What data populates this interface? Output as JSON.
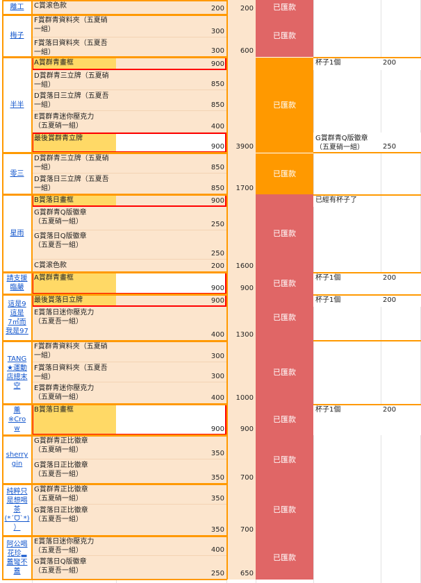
{
  "colors": {
    "peach": "#fce5cd",
    "yellow": "#ffd966",
    "red_status": "#e06666",
    "orange_status": "#ff9900",
    "orange_border": "#ff9900",
    "red_border": "#ff0000",
    "link": "#1155cc",
    "grid": "#e2e2e2"
  },
  "groups": [
    {
      "name": "離工",
      "total": "200",
      "status": "已匯款",
      "status_color": "red",
      "items": [
        {
          "text": "C賞滚色款",
          "price": "200"
        }
      ]
    },
    {
      "name": "梅子",
      "total": "600",
      "status": "已匯款",
      "status_color": "red",
      "items": [
        {
          "text": "F賞群青資料夾（五夏硝\n一組）",
          "price": "300"
        },
        {
          "text": "F賞落日資料夾（五夏吾\n一組）",
          "price": "300"
        }
      ]
    },
    {
      "name": "半半",
      "total": "3900",
      "status": "已匯款",
      "status_color": "orange",
      "items": [
        {
          "text": "A賞群青畫框",
          "price": "900",
          "hl": true
        },
        {
          "text": "D賞群青三立牌（五夏硝\n一組）",
          "price": "850"
        },
        {
          "text": "D賞落日三立牌（五夏吾\n一組）",
          "price": "850"
        },
        {
          "text": "E賞群青迷你壓克力\n（五夏硝一組）",
          "price": "400"
        },
        {
          "text": "最後賞群青立牌",
          "price": "900",
          "hl": true
        }
      ],
      "notes": [
        {
          "text": "杯子1個",
          "value": "200"
        },
        {
          "text": "",
          "value": ""
        },
        {
          "text": "",
          "value": ""
        },
        {
          "text": "",
          "value": ""
        },
        {
          "text": "G賞群青Q版徽章\n（五夏硝一組）",
          "value": "250"
        }
      ]
    },
    {
      "name": "零三",
      "total": "1700",
      "status": "已匯款",
      "status_color": "orange",
      "items": [
        {
          "text": "D賞群青三立牌（五夏硝\n一組）",
          "price": "850"
        },
        {
          "text": "D賞落日三立牌（五夏吾\n一組）",
          "price": "850"
        }
      ]
    },
    {
      "name": "星雨",
      "total": "1600",
      "status": "已匯款",
      "status_color": "red",
      "items": [
        {
          "text": "B賞落日畫框",
          "price": "900",
          "hl": true
        },
        {
          "text": "G賞群青Q版徽章\n（五夏硝一組）",
          "price": "250"
        },
        {
          "text": "G賞落日Q版徽章\n（五夏吾一組）",
          "price": "250"
        },
        {
          "text": "C賞滚色款",
          "price": "200"
        }
      ],
      "notes": [
        {
          "text": "已經有杯子了",
          "value": ""
        }
      ]
    },
    {
      "name": "請支援\n臨嚴",
      "total": "900",
      "status": "已匯款",
      "status_color": "red",
      "items": [
        {
          "text": "A賞群青畫框",
          "price": "900",
          "hl": true
        }
      ],
      "notes": [
        {
          "text": "杯子1個",
          "value": "200"
        }
      ]
    },
    {
      "name": "這是9\n這是\n7㎡而\n我是97",
      "total": "1300",
      "status": "已匯款",
      "status_color": "red",
      "items": [
        {
          "text": "最後賞落日立牌",
          "price": "900",
          "hl": true
        },
        {
          "text": "E賞落日迷你壓克力\n（五夏吾一組）",
          "price": "400"
        }
      ],
      "notes": [
        {
          "text": "杯子1個",
          "value": "200"
        }
      ]
    },
    {
      "name": "TANG\n★運動\n店總末\n空",
      "total": "1000",
      "status": "已匯款",
      "status_color": "red",
      "items": [
        {
          "text": "F賞群青資料夾（五夏硝\n一組）",
          "price": "300"
        },
        {
          "text": "F賞落日資料夾（五夏吾\n一組）",
          "price": "300"
        },
        {
          "text": "E賞群青迷你壓克力\n（五夏硝一組）",
          "price": "400"
        }
      ]
    },
    {
      "name": "薰\n※Cro\nw",
      "total": "900",
      "status": "已匯款",
      "status_color": "red",
      "items": [
        {
          "text": "B賞落日畫框",
          "price": "900",
          "hl": true
        }
      ],
      "notes": [
        {
          "text": "杯子1個",
          "value": "200"
        }
      ]
    },
    {
      "name": "sherry\ngin",
      "total": "700",
      "status": "已匯款",
      "status_color": "red",
      "items": [
        {
          "text": "G賞群青正比徽章\n（五夏硝一組）",
          "price": "350"
        },
        {
          "text": "G賞落日正比徽章\n（五夏吾一組）",
          "price": "350"
        }
      ]
    },
    {
      "name": "純粹只\n是想喝\n茶\n(*ˊᗜˋ*)\n）",
      "total": "700",
      "status": "已匯款",
      "status_color": "red",
      "items": [
        {
          "text": "G賞群青正比徽章\n（五夏硝一組）",
          "price": "350"
        },
        {
          "text": "G賞落日正比徽章\n（五夏吾一組）",
          "price": "350"
        }
      ]
    },
    {
      "name": "阿公喝\n花珍▂\n蓋彎不\n蓋",
      "total": "650",
      "status": "已匯款",
      "status_color": "red",
      "items": [
        {
          "text": "E賞落日迷你壓克力\n（五夏吾一組）",
          "price": "400"
        },
        {
          "text": "G賞落日Q版徽章\n（五夏吾一組）",
          "price": "250"
        }
      ]
    }
  ]
}
